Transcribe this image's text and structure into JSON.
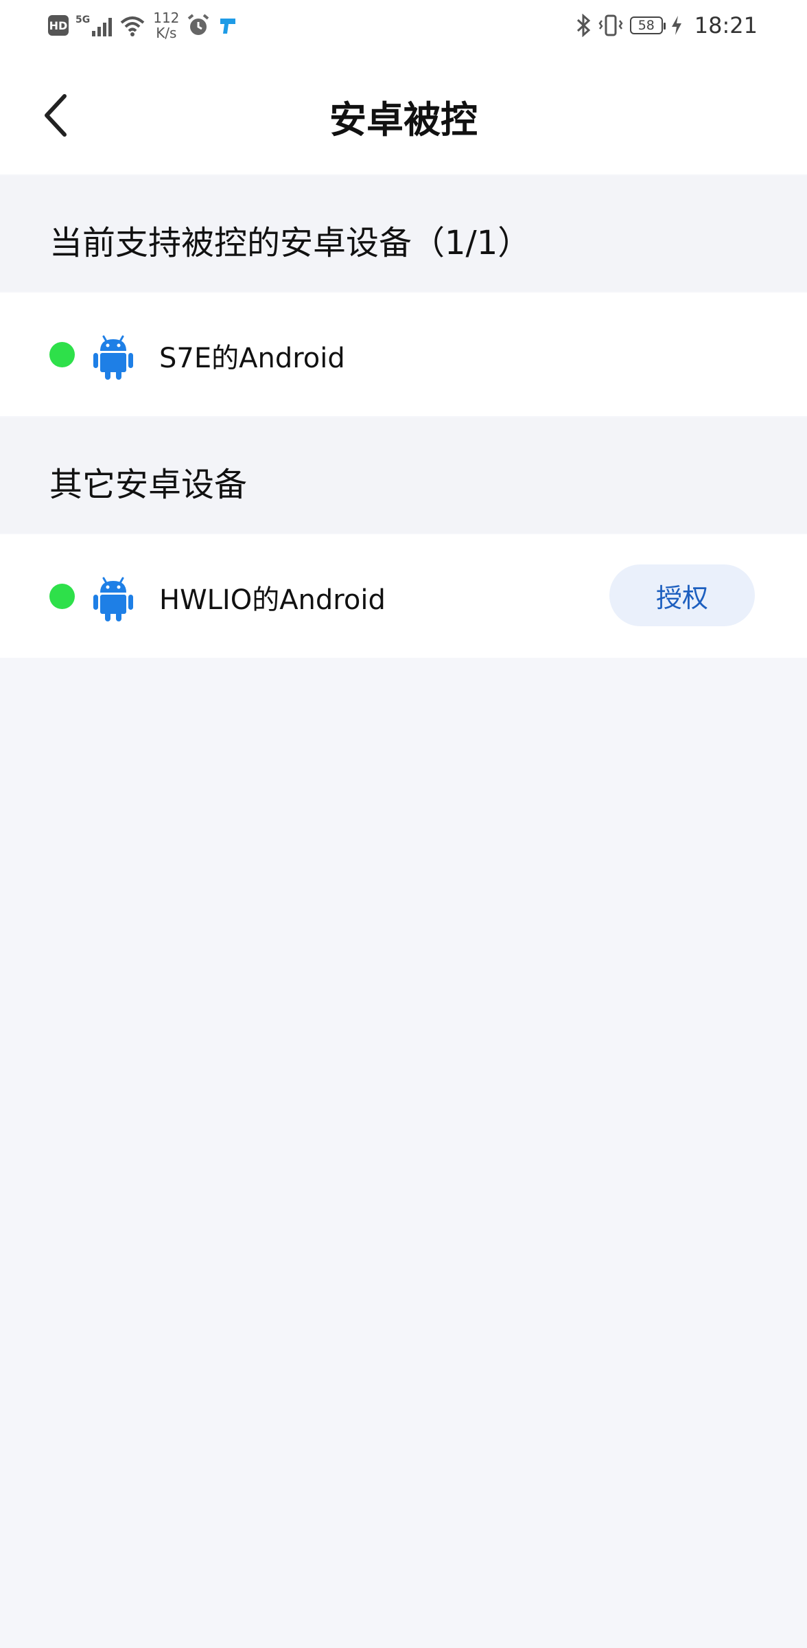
{
  "status_bar": {
    "hd_label": "HD",
    "signal_label": "5G",
    "net_speed_value": "112",
    "net_speed_unit": "K/s",
    "battery_level": "58",
    "time": "18:21",
    "icons": [
      "signal-icon",
      "wifi-icon",
      "alarm-icon",
      "app-notification-icon",
      "bluetooth-icon",
      "vibrate-icon",
      "battery-icon",
      "charging-icon"
    ]
  },
  "header": {
    "title": "安卓被控",
    "back_icon": "chevron-left-icon"
  },
  "sections": [
    {
      "title": "当前支持被控的安卓设备（1/1）",
      "devices": [
        {
          "name": "S7E的Android",
          "status_color": "#2ee04a",
          "icon": "android-icon"
        }
      ]
    },
    {
      "title": "其它安卓设备",
      "devices": [
        {
          "name": "HWLIO的Android",
          "status_color": "#2ee04a",
          "icon": "android-icon",
          "action_label": "授权"
        }
      ]
    }
  ],
  "colors": {
    "accent": "#1d5fbf",
    "android_blue": "#1e7fe6",
    "online_green": "#2ee04a",
    "background": "#f5f6fa"
  }
}
